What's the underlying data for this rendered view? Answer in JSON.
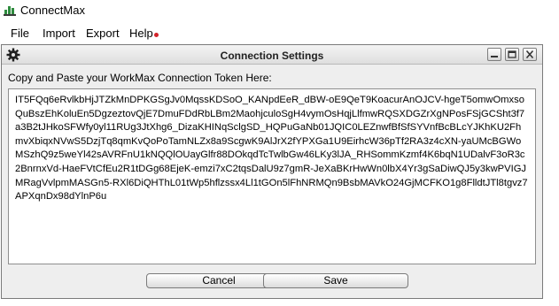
{
  "app": {
    "title": "ConnectMax",
    "logo_icon": "bar-chart-icon"
  },
  "menu": {
    "items": [
      {
        "label": "File"
      },
      {
        "label": "Import"
      },
      {
        "label": "Export"
      },
      {
        "label": "Help"
      }
    ],
    "help_notification_color": "#d2232a"
  },
  "dialog": {
    "title": "Connection Settings",
    "settings_icon": "gear-icon",
    "prompt": "Copy and Paste your WorkMax Connection Token Here:",
    "token": "IT5FQq6eRvlkbHjJTZkMnDPKGSgJv0MqssKDSoO_KANpdEeR_dBW-oE9QeT9KoacurAnOJCV-hgeT5omwOmxsoQuBszEhKoluEn5DgzeztovQjE7DmuFDdRbLBm2MaohjculoSgH4vymOsHqjLlfmwRQSXDGZrXgNPosFSjGCSht3f7a3B2tJHkoSFWfy0yl11RUg3JtXhg6_DizaKHINqSclgSD_HQPuGaNb01JQIC0LEZnwfBfSfSYVnfBcBLcYJKhKU2FhmvXbiqxNVwS5DzjTq8qmKvQoPoTamNLZx8a9ScgwK9AlJrX2fYPXGa1U9EirhcW36pTf2RA3z4cXN-yaUMcBGWoMSzhQ9z5weYl42sAVRFnU1kNQQlOUayGlfr88DOkqdTcTwlbGw46LKy3lJA_RHSommKzmf4K6bqN1UDalvF3oR3c2BnrnxVd-HaeFVtCfEu2R1tDGg68EjeK-emzi7xC2tqsDalU9z7gmR-JeXaBKrHwWn0lbX4Yr3gSaDiwQJ5y3kwPVIGJMRagVvlpmMASGn5-RXl6DiQHThL01tWp5hflzssx4Ll1tGOn5lFhNRMQn9BsbMAVkO24GjMCFKO1g8FlldtJTl8tgvz7APXqnDx98dYlnP6u",
    "buttons": {
      "cancel": "Cancel",
      "save": "Save"
    },
    "window_icons": [
      "minimize-icon",
      "maximize-icon",
      "close-icon"
    ]
  }
}
